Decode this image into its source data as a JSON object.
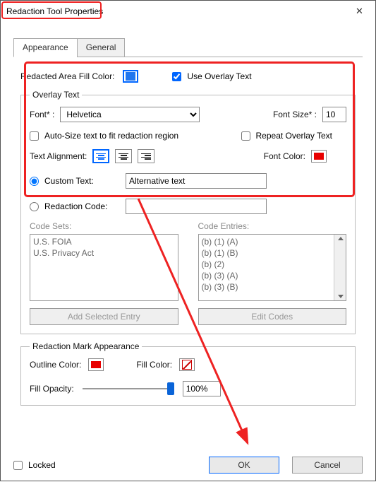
{
  "window": {
    "title": "Redaction Tool Properties"
  },
  "tabs": {
    "appearance": "Appearance",
    "general": "General"
  },
  "top": {
    "fill_label": "Redacted Area Fill Color:",
    "use_overlay": "Use Overlay Text"
  },
  "overlay": {
    "legend": "Overlay Text",
    "font_label": "Font* :",
    "font_value": "Helvetica",
    "size_label": "Font Size* :",
    "size_value": "10",
    "auto_size": "Auto-Size text to fit redaction region",
    "repeat": "Repeat Overlay Text",
    "align_label": "Text Alignment:",
    "color_label": "Font Color:",
    "custom_label": "Custom Text:",
    "custom_value": "Alternative text",
    "redcode_label": "Redaction Code:",
    "sets_label": "Code Sets:",
    "entries_label": "Code Entries:",
    "sets": [
      "U.S. FOIA",
      "U.S. Privacy Act"
    ],
    "entries": [
      "(b) (1) (A)",
      "(b) (1) (B)",
      "(b) (2)",
      "(b) (3) (A)",
      "(b) (3) (B)"
    ],
    "btn_add": "Add Selected Entry",
    "btn_edit": "Edit Codes"
  },
  "mark": {
    "legend": "Redaction Mark Appearance",
    "outline_label": "Outline Color:",
    "fill_label": "Fill Color:",
    "opacity_label": "Fill Opacity:",
    "opacity_value": "100%"
  },
  "footer": {
    "locked": "Locked",
    "ok": "OK",
    "cancel": "Cancel"
  },
  "colors": {
    "black": "#000",
    "red": "#e80000"
  }
}
